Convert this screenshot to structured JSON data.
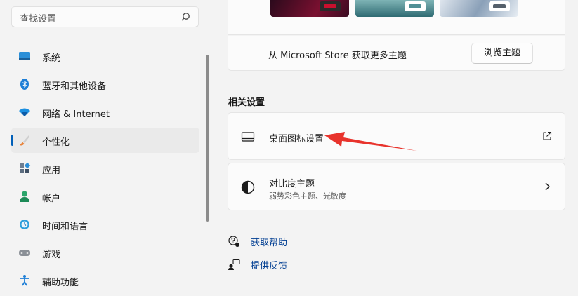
{
  "search": {
    "placeholder": "查找设置"
  },
  "sidebar": {
    "items": [
      {
        "label": "系统",
        "icon": "system-icon"
      },
      {
        "label": "蓝牙和其他设备",
        "icon": "bluetooth-icon"
      },
      {
        "label": "网络 & Internet",
        "icon": "network-icon"
      },
      {
        "label": "个性化",
        "icon": "brush-icon",
        "active": true
      },
      {
        "label": "应用",
        "icon": "apps-icon"
      },
      {
        "label": "帐户",
        "icon": "account-icon"
      },
      {
        "label": "时间和语言",
        "icon": "time-language-icon"
      },
      {
        "label": "游戏",
        "icon": "gaming-icon"
      },
      {
        "label": "辅助功能",
        "icon": "accessibility-icon"
      }
    ]
  },
  "themes": {
    "store_text": "从 Microsoft Store 获取更多主题",
    "browse_label": "浏览主题"
  },
  "related": {
    "title": "相关设置",
    "desktop_icons": {
      "title": "桌面图标设置"
    },
    "contrast": {
      "title": "对比度主题",
      "subtitle": "弱势彩色主题、光敏度"
    }
  },
  "links": {
    "help": "获取帮助",
    "feedback": "提供反馈"
  },
  "colors": {
    "accent": "#005fb8",
    "link": "#003e92",
    "annotation": "#e8332c"
  }
}
